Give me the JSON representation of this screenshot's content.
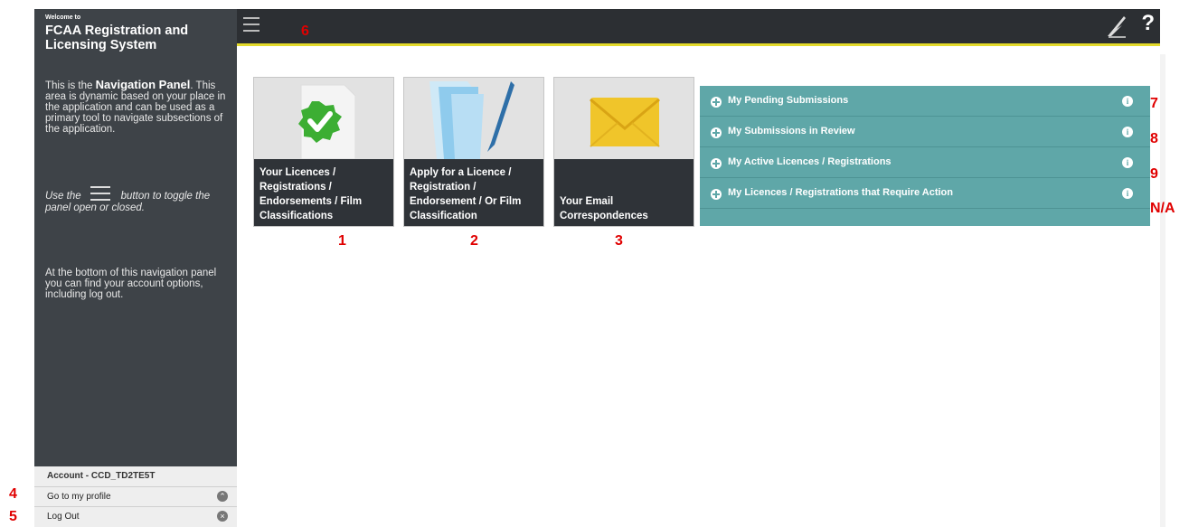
{
  "sidebar": {
    "welcome": "Welcome to",
    "title": "FCAA Registration and Licensing System",
    "intro_prefix": "This is the ",
    "intro_bold": "Navigation Panel",
    "intro_rest": ". This area is dynamic based on your place in the application and can be used as a primary tool to navigate subsections of the application.",
    "toggle_prefix": "Use the",
    "toggle_suffix": "button to toggle the panel open or closed.",
    "bottom_note": "At the bottom of this navigation panel you can find your account options, including log out."
  },
  "account": {
    "header": "Account - CCD_TD2TE5T",
    "profile_label": "Go to my profile",
    "logout_label": "Log Out"
  },
  "topbar": {
    "help_label": "?"
  },
  "cards": [
    {
      "label": "Your Licences / Registrations / Endorsements / Film Classifications",
      "icon": "checkmark-document-icon"
    },
    {
      "label": "Apply for a Licence / Registration / Endorsement / Or Film Classification",
      "icon": "folder-pen-icon"
    },
    {
      "label": "Your Email Correspondences",
      "icon": "envelope-icon"
    }
  ],
  "panel": {
    "rows": [
      {
        "label": "My Pending Submissions"
      },
      {
        "label": "My Submissions in Review"
      },
      {
        "label": "My Active Licences / Registrations"
      },
      {
        "label": "My Licences / Registrations that Require Action"
      }
    ],
    "info_glyph": "i"
  },
  "annotations": {
    "n1": "1",
    "n2": "2",
    "n3": "3",
    "n4": "4",
    "n5": "5",
    "n6": "6",
    "n7": "7",
    "n8": "8",
    "n9": "9",
    "na": "N/A"
  },
  "colors": {
    "sidebar": "#3e4348",
    "topbar": "#2c2f33",
    "accent": "#e3da2b",
    "panel": "#5fa7a8",
    "annotation": "#e00000"
  }
}
